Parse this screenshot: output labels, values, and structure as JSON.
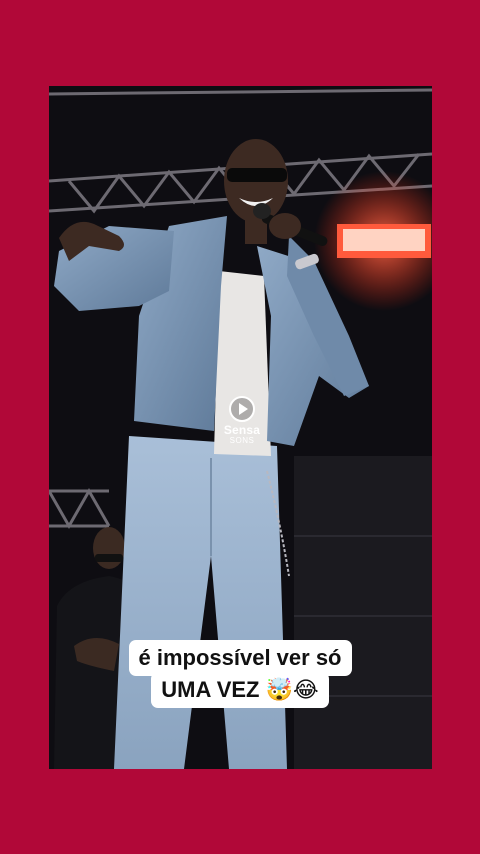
{
  "watermark": {
    "brand": "Sensa",
    "sub": "SONS",
    "icon": "play-circle-icon"
  },
  "caption": {
    "line1": "é impossível ver só",
    "line2": "UMA VEZ 🤯😂"
  },
  "colors": {
    "background": "#b10838",
    "caption_bg": "#ffffff",
    "caption_text": "#111111"
  }
}
